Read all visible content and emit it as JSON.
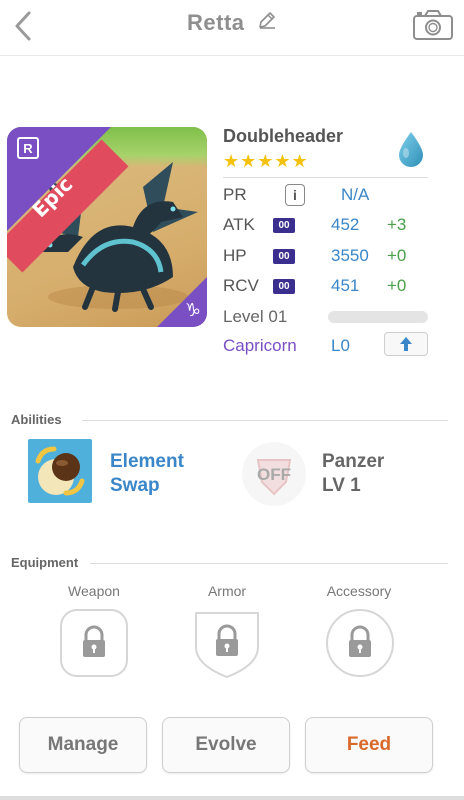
{
  "header": {
    "title": "Retta",
    "back_icon": "chevron-left-icon",
    "edit_icon": "pencil-icon",
    "camera_icon": "camera-icon"
  },
  "monster": {
    "rarity": "Epic",
    "rank_badge": "R",
    "name": "Doubleheader",
    "stars": "★★★★★",
    "star_count": 5,
    "element_icon": "water-drop-icon",
    "stats": {
      "pr": {
        "label": "PR",
        "value": "N/A"
      },
      "atk": {
        "label": "ATK",
        "tag": "00",
        "value": "452",
        "bonus": "+3"
      },
      "hp": {
        "label": "HP",
        "tag": "00",
        "value": "3550",
        "bonus": "+0"
      },
      "rcv": {
        "label": "RCV",
        "tag": "00",
        "value": "451",
        "bonus": "+0"
      }
    },
    "level_label": "Level 01",
    "level_progress": 0,
    "zodiac": {
      "name": "Capricorn",
      "level": "L0",
      "glyph": "♑"
    }
  },
  "abilities": {
    "title": "Abilities",
    "active": {
      "name_line1": "Element",
      "name_line2": "Swap"
    },
    "passive": {
      "state": "OFF",
      "name_line1": "Panzer",
      "name_line2": "LV 1"
    }
  },
  "equipment": {
    "title": "Equipment",
    "slots": [
      {
        "label": "Weapon"
      },
      {
        "label": "Armor"
      },
      {
        "label": "Accessory"
      }
    ]
  },
  "actions": {
    "manage": "Manage",
    "evolve": "Evolve",
    "feed": "Feed"
  },
  "colors": {
    "accent_blue": "#3a86c8",
    "bonus_green": "#4aa04a",
    "zodiac_purple": "#7b4fc4",
    "feed_orange": "#d9692a",
    "epic_red": "#e04b5e"
  }
}
